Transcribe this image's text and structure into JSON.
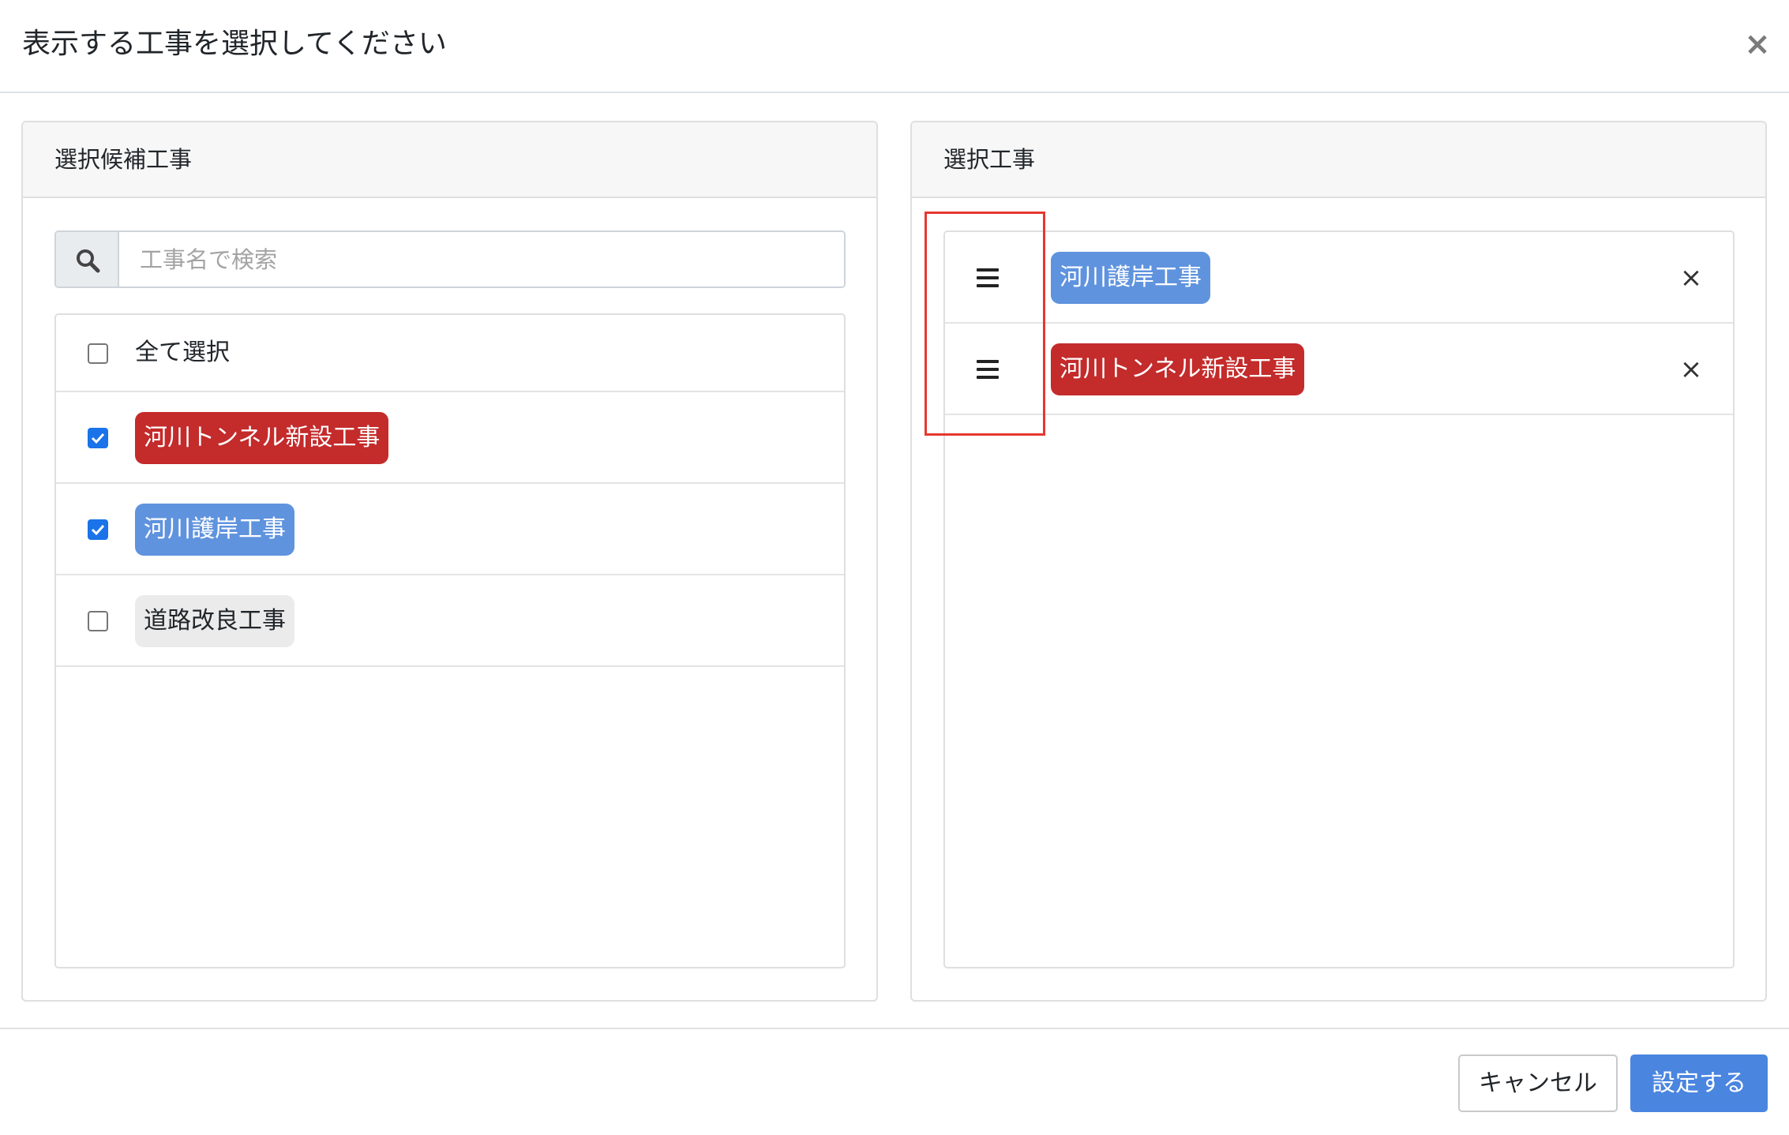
{
  "modal": {
    "title": "表示する工事を選択してください",
    "close_label": "×"
  },
  "left_panel": {
    "header": "選択候補工事",
    "search": {
      "placeholder": "工事名で検索",
      "value": ""
    },
    "select_all": {
      "label": "全て選択",
      "checked": false
    },
    "items": [
      {
        "label": "河川トンネル新設工事",
        "checked": true,
        "color": "#c42b2b"
      },
      {
        "label": "河川護岸工事",
        "checked": true,
        "color": "#5f93de"
      },
      {
        "label": "道路改良工事",
        "checked": false,
        "color": "#ebebeb"
      }
    ]
  },
  "right_panel": {
    "header": "選択工事",
    "items": [
      {
        "label": "河川護岸工事",
        "color": "#5f93de",
        "remove_label": "×"
      },
      {
        "label": "河川トンネル新設工事",
        "color": "#c42b2b",
        "remove_label": "×"
      }
    ]
  },
  "footer": {
    "cancel_label": "キャンセル",
    "submit_label": "設定する"
  },
  "highlight_color": "#e5382f"
}
